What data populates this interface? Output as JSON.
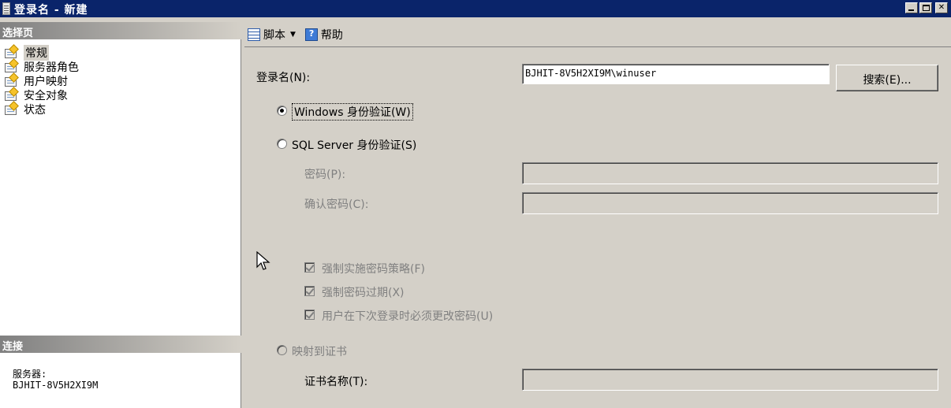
{
  "window": {
    "title": "登录名 - 新建"
  },
  "left_pane": {
    "select_page_header": "选择页",
    "pages": [
      {
        "label": "常规",
        "selected": true
      },
      {
        "label": "服务器角色",
        "selected": false
      },
      {
        "label": "用户映射",
        "selected": false
      },
      {
        "label": "安全对象",
        "selected": false
      },
      {
        "label": "状态",
        "selected": false
      }
    ],
    "connection_header": "连接",
    "server_label": "服务器:",
    "server_value": "BJHIT-8V5H2XI9M"
  },
  "toolbar": {
    "script_label": "脚本",
    "help_label": "帮助"
  },
  "form": {
    "login_name_label": "登录名(N):",
    "login_name_value": "BJHIT-8V5H2XI9M\\winuser",
    "search_button": "搜索(E)...",
    "windows_auth_label": "Windows 身份验证(W)",
    "windows_auth_selected": true,
    "sql_auth_label": "SQL Server 身份验证(S)",
    "sql_auth_selected": false,
    "password_label": "密码(P):",
    "confirm_password_label": "确认密码(C):",
    "enforce_policy_label": "强制实施密码策略(F)",
    "enforce_expiration_label": "强制密码过期(X)",
    "must_change_label": "用户在下次登录时必须更改密码(U)",
    "map_cert_label": "映射到证书",
    "cert_name_label": "证书名称(T):"
  }
}
